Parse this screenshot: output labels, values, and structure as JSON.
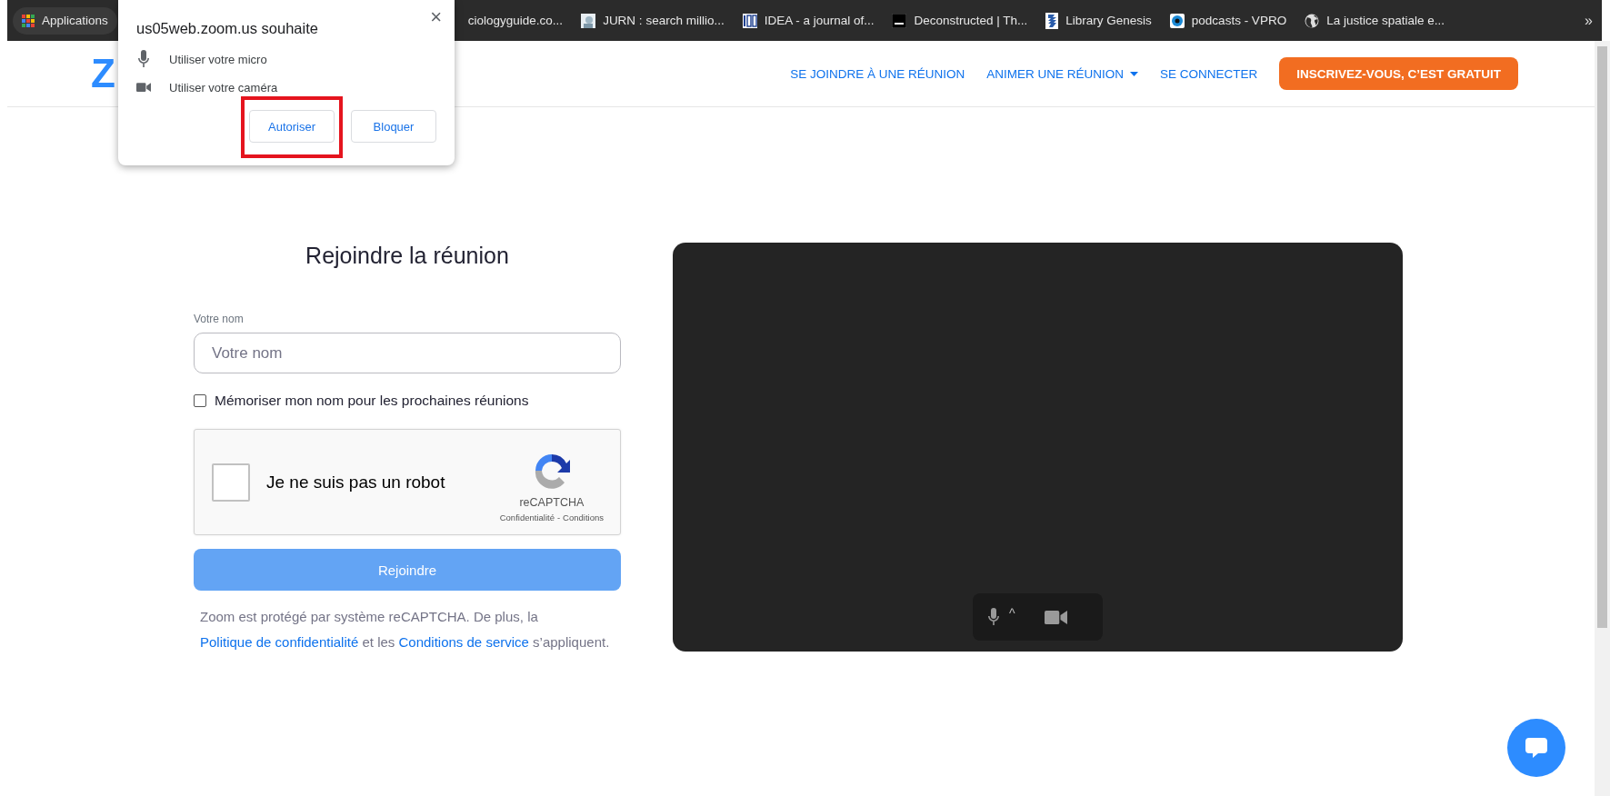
{
  "bookmarks": [
    {
      "label": "Applications"
    },
    {
      "label": "ciologyguide.co..."
    },
    {
      "label": "JURN : search millio..."
    },
    {
      "label": "IDEA - a journal of..."
    },
    {
      "label": "Deconstructed | Th..."
    },
    {
      "label": "Library Genesis"
    },
    {
      "label": "podcasts - VPRO"
    },
    {
      "label": "La justice spatiale e..."
    }
  ],
  "bookmarks_more": "»",
  "permission_popup": {
    "title": "us05web.zoom.us souhaite",
    "close": "×",
    "permissions": [
      {
        "kind": "mic",
        "label": "Utiliser votre micro"
      },
      {
        "kind": "camera",
        "label": "Utiliser votre caméra"
      }
    ],
    "buttons": [
      {
        "label": "Autoriser",
        "highlighted": true
      },
      {
        "label": "Bloquer",
        "highlighted": false
      }
    ]
  },
  "nav": {
    "logo": "Z",
    "links": [
      {
        "label": "SE JOINDRE À UNE RÉUNION",
        "dropdown": false
      },
      {
        "label": "ANIMER UNE RÉUNION",
        "dropdown": true
      },
      {
        "label": "SE CONNECTER",
        "dropdown": false
      }
    ],
    "signup": "INSCRIVEZ-VOUS, C’EST GRATUIT"
  },
  "form": {
    "title": "Rejoindre la réunion",
    "name_label": "Votre nom",
    "name_placeholder": "Votre nom",
    "remember": {
      "label": "Mémoriser mon nom pour les prochaines réunions",
      "checked": false
    },
    "captcha": {
      "label": "Je ne suis pas un robot",
      "checked": false,
      "brand": "reCAPTCHA",
      "privacy": "Confidentialité",
      "separator": "-",
      "terms": "Conditions"
    },
    "submit": "Rejoindre",
    "notice": [
      {
        "kind": "text",
        "text": "Zoom est protégé par système reCAPTCHA. De plus, la "
      },
      {
        "kind": "link",
        "text": "Politique de confidentialité"
      },
      {
        "kind": "text",
        "text": " et les "
      },
      {
        "kind": "link",
        "text": "Conditions de service"
      },
      {
        "kind": "text",
        "text": " s’appliquent."
      }
    ]
  },
  "preview": {
    "controls": [
      {
        "kind": "mic"
      },
      {
        "kind": "caret",
        "label": "^"
      },
      {
        "kind": "camera"
      }
    ]
  }
}
